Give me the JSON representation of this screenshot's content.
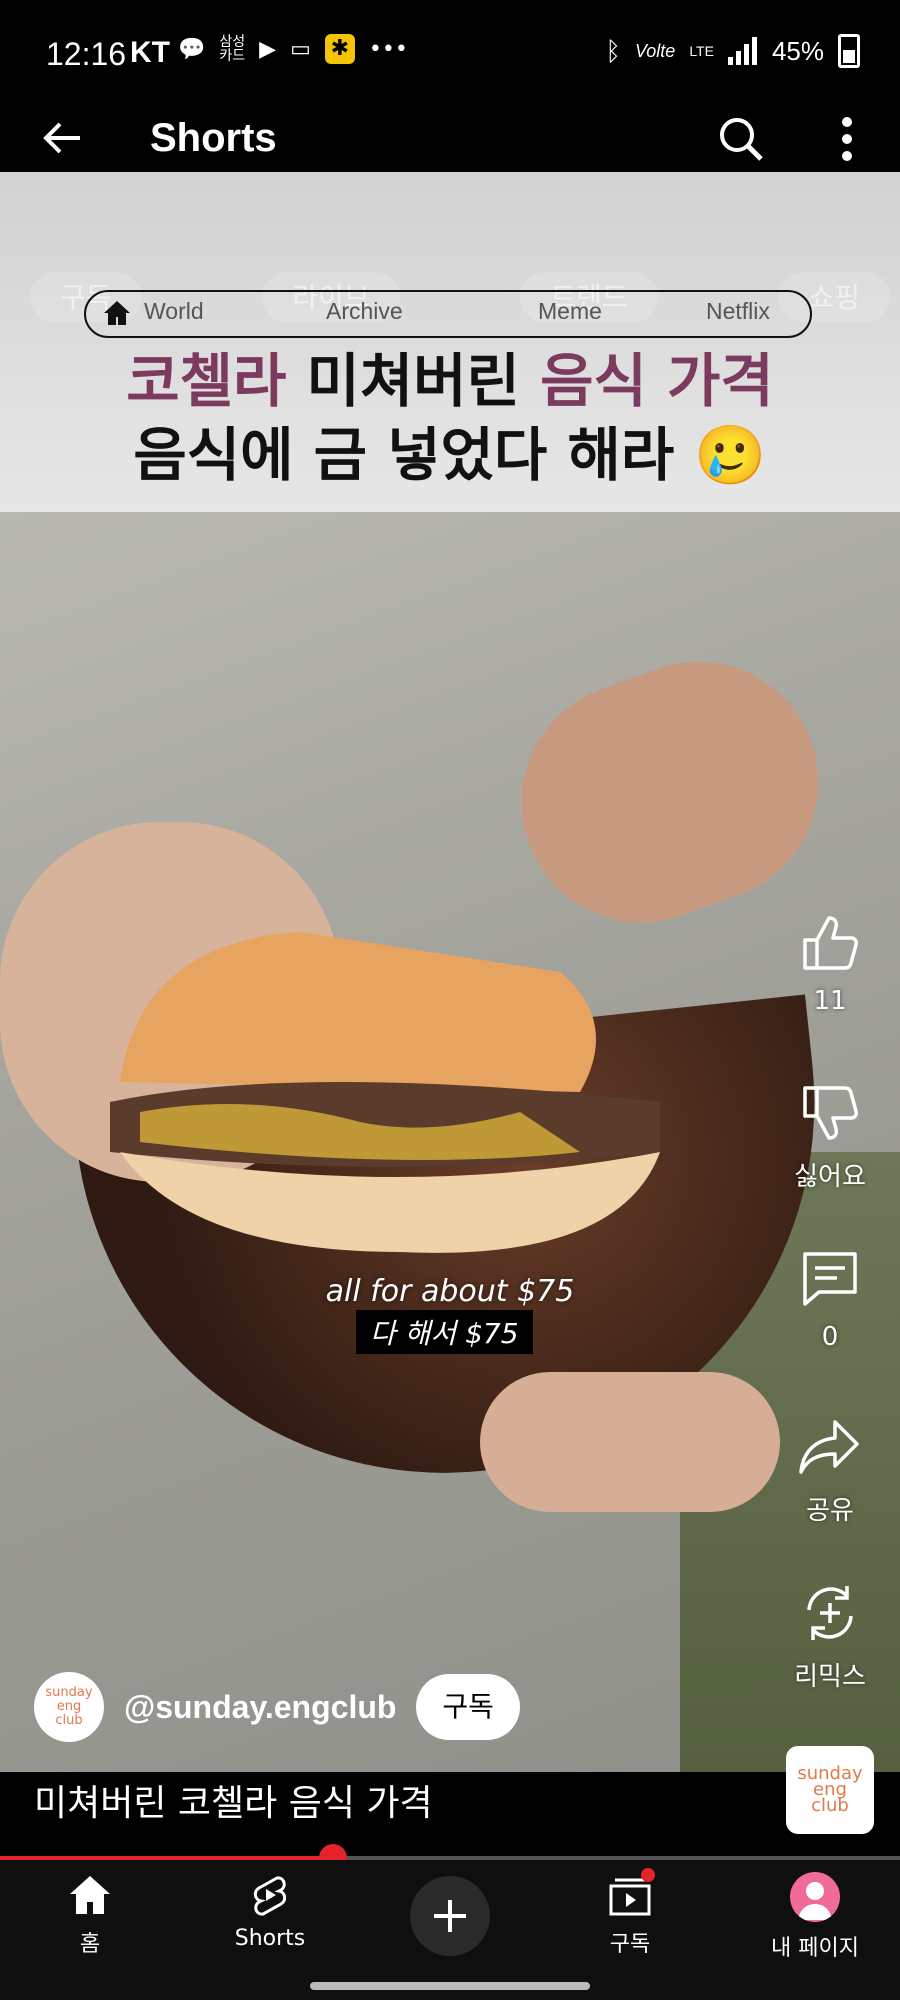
{
  "status_bar": {
    "time": "12:16",
    "carrier": "KT",
    "samsung_card": "삼성\n카드",
    "battery": "45%",
    "lte": "LTE",
    "volte": "Volte"
  },
  "app_bar": {
    "title": "Shorts"
  },
  "banner": {
    "chips": [
      "구독",
      "라이브",
      "트렌드",
      "쇼핑"
    ],
    "pill_tabs": [
      "World",
      "Archive",
      "Meme",
      "Netflix"
    ],
    "headline_line1": [
      "코첼라",
      " 미쳐버린 ",
      "음식 가격"
    ],
    "headline_line2": "음식에 금 넣었다 해라 🥲"
  },
  "captions": {
    "english": "all for about $75",
    "korean": "다 해서 $75"
  },
  "actions": {
    "like_count": "11",
    "dislike_label": "싫어요",
    "comment_count": "0",
    "share_label": "공유",
    "remix_label": "리믹스"
  },
  "channel": {
    "handle": "@sunday.engclub",
    "avatar_text": "sunday\neng\nclub",
    "subscribe_label": "구독"
  },
  "short": {
    "title": "미쳐버린 코첼라 음식 가격",
    "progress": 0.37
  },
  "bottom_nav": {
    "home": "홈",
    "shorts": "Shorts",
    "subscriptions": "구독",
    "my_page": "내 페이지"
  },
  "colors": {
    "accent_red": "#e3242b",
    "headline_purple": "#7b3a5e"
  }
}
